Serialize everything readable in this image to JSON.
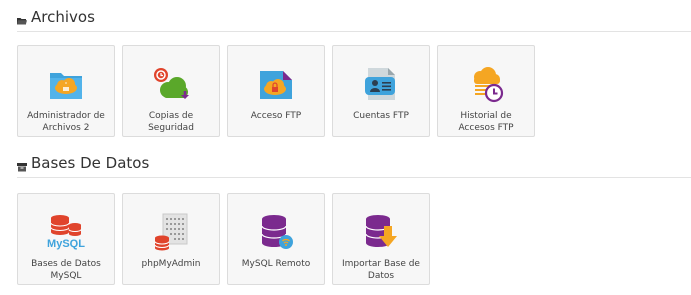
{
  "sections": [
    {
      "title": "Archivos",
      "icon": "folder-icon",
      "items": [
        {
          "label": "Administrador de Archivos 2",
          "icon": "file-manager-icon"
        },
        {
          "label": "Copias de Seguridad",
          "icon": "backup-icon"
        },
        {
          "label": "Acceso FTP",
          "icon": "ftp-access-icon"
        },
        {
          "label": "Cuentas FTP",
          "icon": "ftp-accounts-icon"
        },
        {
          "label": "Historial de Accesos FTP",
          "icon": "ftp-history-icon"
        }
      ]
    },
    {
      "title": "Bases De Datos",
      "icon": "database-box-icon",
      "items": [
        {
          "label": "Bases de Datos MySQL",
          "icon": "mysql-icon"
        },
        {
          "label": "phpMyAdmin",
          "icon": "phpmyadmin-icon"
        },
        {
          "label": "MySQL Remoto",
          "icon": "remote-mysql-icon"
        },
        {
          "label": "Importar Base de Datos",
          "icon": "import-database-icon"
        }
      ]
    }
  ],
  "colors": {
    "blue": "#3fa3dc",
    "orange": "#f5a623",
    "green": "#5aa82a",
    "red": "#e0442c",
    "purple": "#7b2a8e"
  },
  "icon_text": {
    "mysql_logo": "MySQL"
  }
}
